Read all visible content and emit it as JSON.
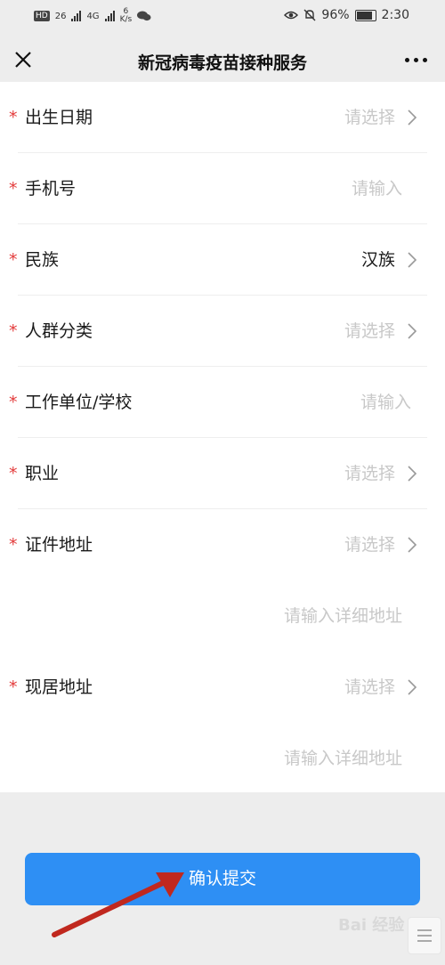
{
  "status_bar": {
    "hd": "HD",
    "sim1": "26",
    "sim2": "4G",
    "net_speed_value": "6",
    "net_speed_unit": "K/s",
    "battery_percent_text": "96%",
    "battery_level": 0.96,
    "time": "2:30",
    "icons": [
      "wechat-icon",
      "eye-icon",
      "bell-off-icon",
      "battery-icon"
    ]
  },
  "nav": {
    "title": "新冠病毒疫苗接种服务",
    "close_icon": "close-icon",
    "more_icon": "more-icon"
  },
  "form": {
    "rows": [
      {
        "label": "出生日期",
        "value": "请选择",
        "type": "select"
      },
      {
        "label": "手机号",
        "value": "请输入",
        "type": "input"
      },
      {
        "label": "民族",
        "value": "汉族",
        "type": "select"
      },
      {
        "label": "人群分类",
        "value": "请选择",
        "type": "select"
      },
      {
        "label": "工作单位/学校",
        "value": "请输入",
        "type": "input"
      },
      {
        "label": "职业",
        "value": "请选择",
        "type": "select"
      },
      {
        "label": "证件地址",
        "value": "请选择",
        "type": "select"
      },
      {
        "label": "",
        "value": "请输入详细地址",
        "type": "input"
      },
      {
        "label": "现居地址",
        "value": "请选择",
        "type": "select"
      },
      {
        "label": "",
        "value": "请输入详细地址",
        "type": "input"
      }
    ],
    "required_mark": "*"
  },
  "submit": {
    "label": "确认提交"
  },
  "watermark": {
    "text": "Bai 经验"
  }
}
